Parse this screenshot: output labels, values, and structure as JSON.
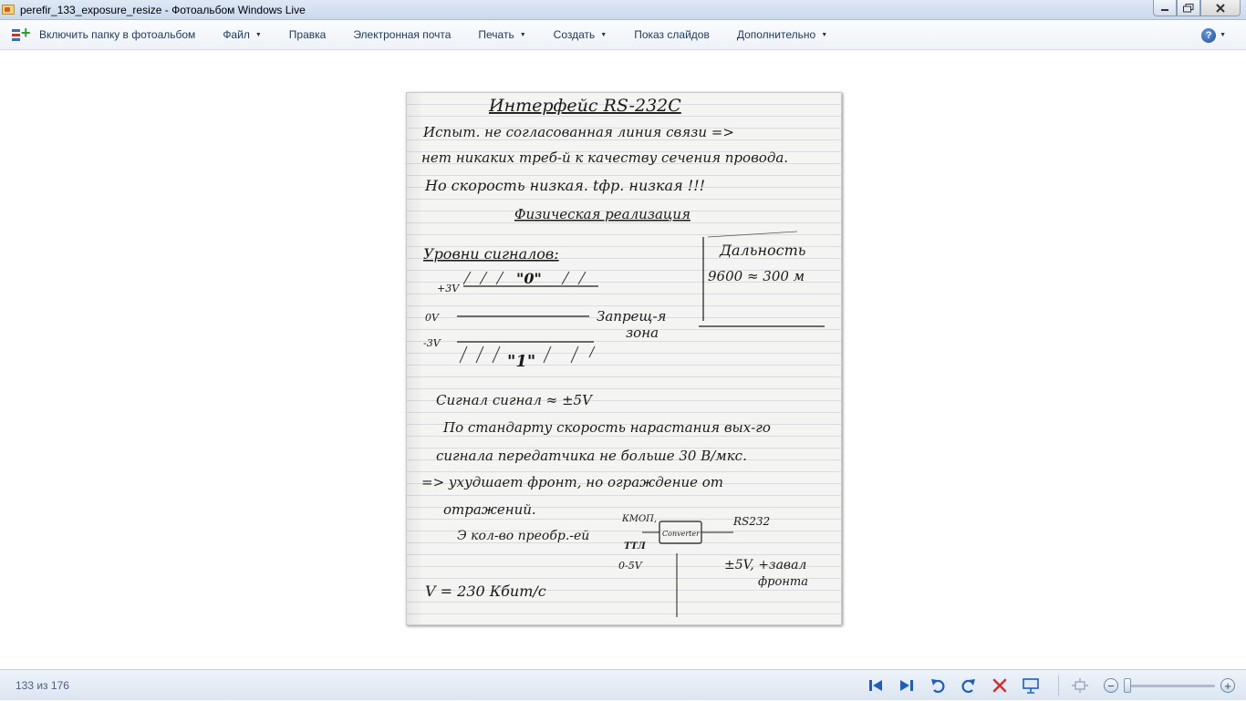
{
  "window": {
    "title": "perefir_133_exposure_resize - Фотоальбом Windows Live",
    "controls": {
      "minimize": "minimize-icon",
      "maximize": "maximize-icon",
      "close": "close-icon"
    }
  },
  "menubar": {
    "include_label": "Включить папку в фотоальбом",
    "items": [
      {
        "label": "Файл",
        "dropdown": true
      },
      {
        "label": "Правка",
        "dropdown": false
      },
      {
        "label": "Электронная почта",
        "dropdown": false
      },
      {
        "label": "Печать",
        "dropdown": true
      },
      {
        "label": "Создать",
        "dropdown": true
      },
      {
        "label": "Показ слайдов",
        "dropdown": false
      },
      {
        "label": "Дополнительно",
        "dropdown": true
      }
    ],
    "help_icon": "help-icon"
  },
  "photo": {
    "title": "Интерфейс RS-232C",
    "lines": [
      "Испыт. не согласованная линия связи =>",
      "нет никаких треб-й к качеству сечения провода.",
      "Но скорость низкая. tфр. низкая !!!",
      "Физическая реализация",
      "Уровни сигналов:",
      "+3V",
      "\"0\"",
      "0V",
      "Запрещ-я",
      "зона",
      "-3V",
      "\"1\"",
      "Дальность",
      "9600 ≈ 300 м",
      "Сигнал сигнал ≈ ±5V",
      "По стандарту скорость нарастания вых-го",
      "сигнала передатчика не больше 30 В/мкс.",
      "=> ухудшает фронт, но ограждение от",
      "отражений.",
      "Э кол-во преобр.-ей",
      "КМОП,",
      "ТТЛ",
      "0-5V",
      "Converter",
      "RS232",
      "±5V, +завал",
      "фронта",
      "V = 230 Кбит/с"
    ]
  },
  "status": {
    "counter": "133 из 176"
  },
  "navigation": {
    "buttons": [
      "previous-icon",
      "next-icon",
      "rotate-left-icon",
      "rotate-right-icon",
      "delete-icon",
      "slideshow-icon"
    ],
    "zoom": {
      "fit_icon": "fit-to-window-icon",
      "zoom_out_icon": "zoom-out-icon",
      "zoom_in_icon": "zoom-in-icon",
      "level": 0.0
    }
  },
  "colors": {
    "menu_text": "#1e395b",
    "status_text": "#49607e",
    "nav_blue": "#1f5fb8",
    "delete_red": "#d03030"
  }
}
